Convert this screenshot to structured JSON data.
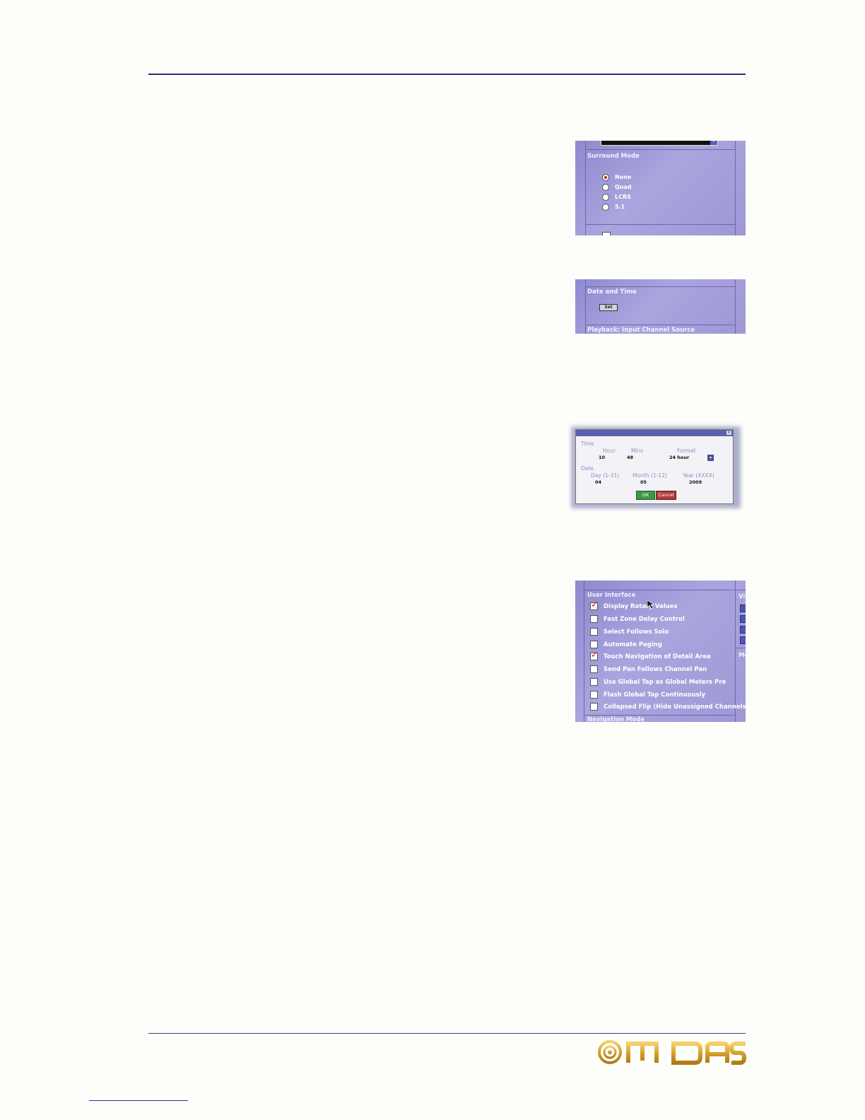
{
  "surround_panel": {
    "section_title": "Surround Mode",
    "options": [
      "None",
      "Quad",
      "LCRS",
      "5.1"
    ],
    "selected": "None"
  },
  "datetime_panel": {
    "section_title": "Date and Time",
    "set_button": "Set",
    "next_section": "Playback: Input Channel Source"
  },
  "time_dialog": {
    "time_heading": "Time",
    "hour_label": "Hour",
    "mins_label": "Mins",
    "format_label": "Format",
    "hour_value": "10",
    "mins_value": "48",
    "format_value": "24 hour",
    "date_heading": "Date",
    "day_label": "Day (1-31)",
    "month_label": "Month (1-12)",
    "year_label": "Year (XXXX)",
    "day_value": "04",
    "month_value": "05",
    "year_value": "2009",
    "ok_label": "OK",
    "cancel_label": "Cancel"
  },
  "ui_panel": {
    "section_title": "User Interface",
    "options": [
      {
        "label": "Display Rotary Values",
        "checked": true
      },
      {
        "label": "Fast Zone Delay Control",
        "checked": false
      },
      {
        "label": "Select Follows Solo",
        "checked": false
      },
      {
        "label": "Automate Paging",
        "checked": false
      },
      {
        "label": "Touch Navigation of Detail Area",
        "checked": true
      },
      {
        "label": "Send Pan Follows Channel Pan",
        "checked": false
      },
      {
        "label": "Use Global Tap as Global Meters Pre",
        "checked": false
      },
      {
        "label": "Flash Global Tap Continuously",
        "checked": false
      },
      {
        "label": "Collapsed Flip (Hide Unassigned Channels)",
        "checked": false
      }
    ],
    "next_section": "Navigation Mode",
    "side_text_1": "Vi",
    "side_text_2": "Me"
  },
  "footer": {
    "logo_text": "MIDAS"
  }
}
